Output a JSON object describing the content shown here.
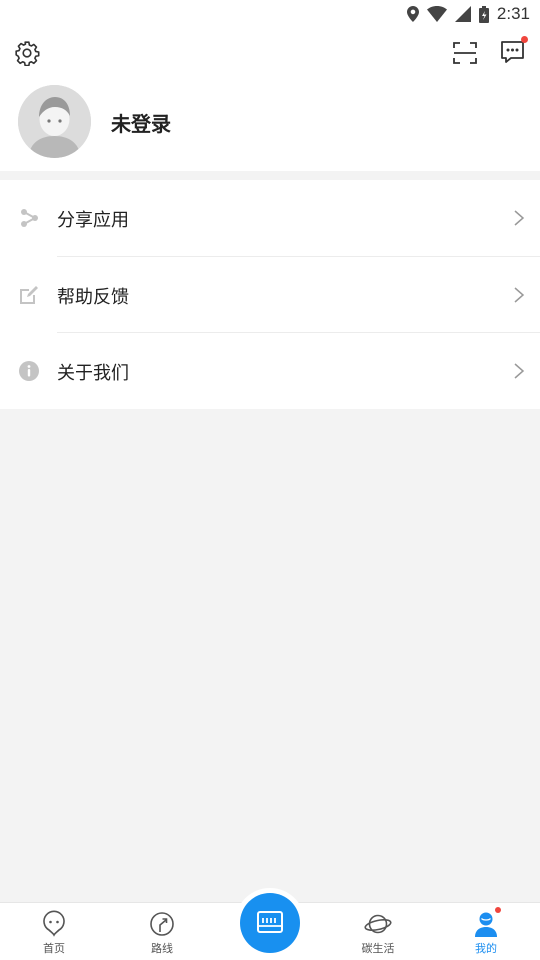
{
  "status_bar": {
    "time": "2:31"
  },
  "header": {
    "username": "未登录"
  },
  "menu": {
    "items": [
      {
        "label": "分享应用",
        "icon": "share-icon"
      },
      {
        "label": "帮助反馈",
        "icon": "edit-icon"
      },
      {
        "label": "关于我们",
        "icon": "info-icon"
      }
    ]
  },
  "tabbar": {
    "tabs": [
      {
        "label": "首页",
        "icon": "home-icon"
      },
      {
        "label": "路线",
        "icon": "route-icon"
      },
      {
        "label": "",
        "icon": "bus-card-icon"
      },
      {
        "label": "碳生活",
        "icon": "planet-icon"
      },
      {
        "label": "我的",
        "icon": "profile-icon",
        "active": true
      }
    ]
  },
  "colors": {
    "accent": "#1890f0",
    "badge": "#f0463e",
    "background": "#f3f3f3"
  }
}
